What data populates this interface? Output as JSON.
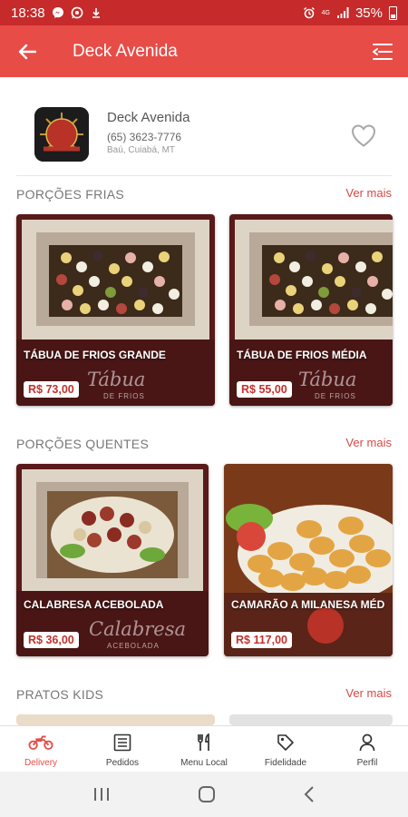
{
  "status_bar": {
    "time": "18:38",
    "network": "4G",
    "battery": "35%"
  },
  "app_bar": {
    "title": "Deck Avenida"
  },
  "store": {
    "name": "Deck Avenida",
    "phone": "(65) 3623-7776",
    "address": "Baú, Cuiabá, MT",
    "logo_text": "Deck Avenida"
  },
  "sections": [
    {
      "title": "PORÇÕES FRIAS",
      "see_more": "Ver mais",
      "items": [
        {
          "name": "TÁBUA DE FRIOS GRANDE",
          "price": "R$ 73,00",
          "script": "Tábua",
          "script_sub": "DE FRIOS"
        },
        {
          "name": "TÁBUA DE FRIOS MÉDIA",
          "price": "R$ 55,00",
          "script": "Tábua",
          "script_sub": "DE FRIOS"
        }
      ]
    },
    {
      "title": "PORÇÕES QUENTES",
      "see_more": "Ver mais",
      "items": [
        {
          "name": "CALABRESA ACEBOLADA",
          "price": "R$ 36,00",
          "script": "Calabresa",
          "script_sub": "ACEBOLADA"
        },
        {
          "name": "CAMARÃO A MILANESA MÉD",
          "price": "R$ 117,00"
        }
      ]
    },
    {
      "title": "PRATOS KIDS",
      "see_more": "Ver mais"
    }
  ],
  "bottom_nav": [
    {
      "label": "Delivery",
      "icon": "motorcycle-icon",
      "active": true
    },
    {
      "label": "Pedidos",
      "icon": "list-icon",
      "active": false
    },
    {
      "label": "Menu Local",
      "icon": "cutlery-icon",
      "active": false
    },
    {
      "label": "Fidelidade",
      "icon": "tag-icon",
      "active": false
    },
    {
      "label": "Perfil",
      "icon": "person-icon",
      "active": false
    }
  ],
  "colors": {
    "primary": "#e74c47",
    "status": "#c62a2a",
    "price": "#c0322e"
  }
}
